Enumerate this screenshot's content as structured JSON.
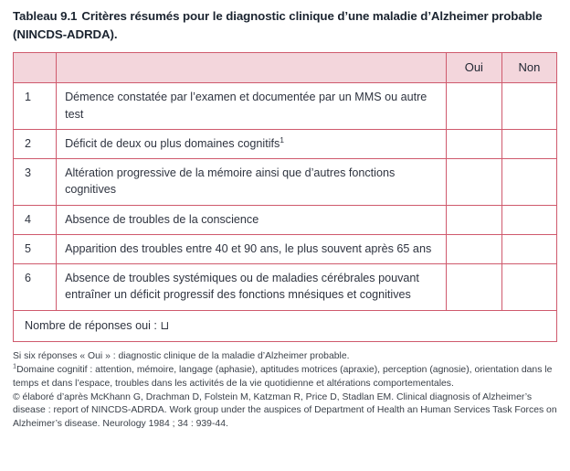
{
  "title": {
    "number": "Tableau 9.1",
    "text": "Critères résumés pour le diagnostic clinique d’une maladie d’Alzheimer probable (NINCDS-ADRDA)."
  },
  "table": {
    "headers": {
      "num": "",
      "criterion": "",
      "oui": "Oui",
      "non": "Non"
    },
    "rows": [
      {
        "num": "1",
        "text": "Démence constatée par l’examen et documentée par un MMS ou autre test",
        "oui": "",
        "non": ""
      },
      {
        "num": "2",
        "text": "Déficit de deux ou plus domaines cognitifs",
        "footnote_marker": "1",
        "oui": "",
        "non": ""
      },
      {
        "num": "3",
        "text": "Altération progressive de la mémoire ainsi que d’autres fonctions cognitives",
        "oui": "",
        "non": ""
      },
      {
        "num": "4",
        "text": "Absence de troubles de la conscience",
        "oui": "",
        "non": ""
      },
      {
        "num": "5",
        "text": "Apparition des troubles entre 40 et 90 ans, le plus souvent après 65 ans",
        "oui": "",
        "non": ""
      },
      {
        "num": "6",
        "text": "Absence de troubles systémiques ou de maladies cérébrales pouvant entraîner un déficit progressif des fonctions mnésiques et cognitives",
        "oui": "",
        "non": ""
      }
    ],
    "footer": {
      "label": "Nombre de réponses oui :",
      "box": "⊔"
    }
  },
  "notes": {
    "line1": "Si six réponses « Oui » : diagnostic clinique de la maladie d’Alzheimer probable.",
    "footnote_marker": "1",
    "footnote1": "Domaine cognitif : attention, mémoire, langage (aphasie), aptitudes motrices (apraxie), perception (agnosie), orientation dans le temps et dans l’espace, troubles dans les activités de la vie quotidienne et altérations comportementales.",
    "copyright": "© élaboré d’après McKhann G, Drachman D, Folstein M, Katzman R, Price D, Stadlan EM. Clinical diagnosis of Alzheimer’s disease : report of NINCDS-ADRDA. Work group under the auspices of Department of Health an Human Services Task Forces on Alzheimer’s disease. Neurology 1984 ; 34 : 939-44."
  },
  "colors": {
    "border_outer": "#a8293d",
    "border_inner": "#cf5a6d",
    "header_fill": "#f3d6dc",
    "text": "#2f3440"
  }
}
